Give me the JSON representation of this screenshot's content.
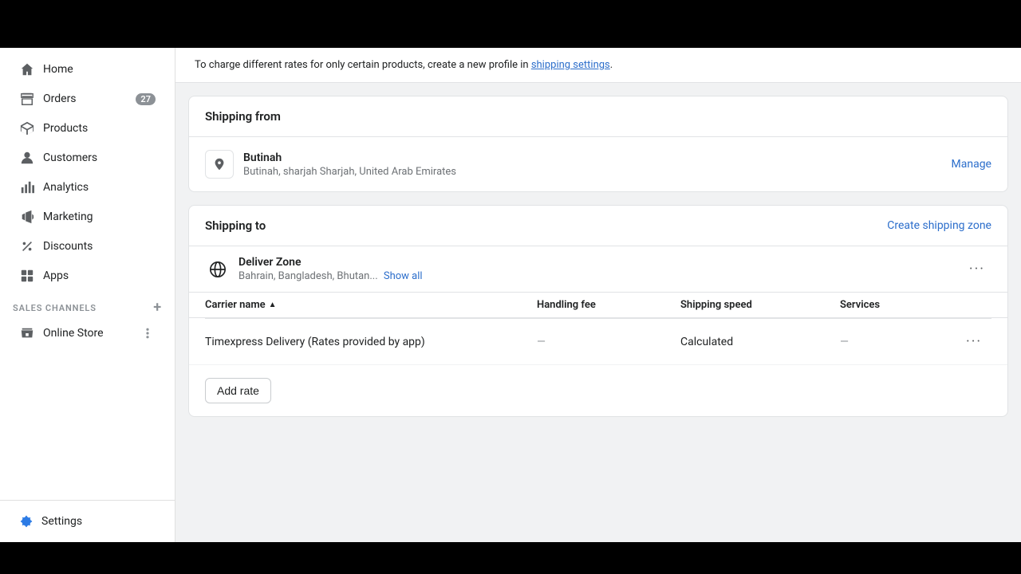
{
  "topBar": {
    "height": 60
  },
  "sidebar": {
    "navItems": [
      {
        "id": "home",
        "label": "Home",
        "icon": "home-icon",
        "badge": null,
        "active": false
      },
      {
        "id": "orders",
        "label": "Orders",
        "icon": "orders-icon",
        "badge": "27",
        "active": false
      },
      {
        "id": "products",
        "label": "Products",
        "icon": "products-icon",
        "badge": null,
        "active": false
      },
      {
        "id": "customers",
        "label": "Customers",
        "icon": "customers-icon",
        "badge": null,
        "active": false
      },
      {
        "id": "analytics",
        "label": "Analytics",
        "icon": "analytics-icon",
        "badge": null,
        "active": false
      },
      {
        "id": "marketing",
        "label": "Marketing",
        "icon": "marketing-icon",
        "badge": null,
        "active": false
      },
      {
        "id": "discounts",
        "label": "Discounts",
        "icon": "discounts-icon",
        "badge": null,
        "active": false
      },
      {
        "id": "apps",
        "label": "Apps",
        "icon": "apps-icon",
        "badge": null,
        "active": false
      }
    ],
    "salesChannelsLabel": "SALES CHANNELS",
    "salesChannelsItems": [
      {
        "id": "online-store",
        "label": "Online Store",
        "icon": "store-icon"
      }
    ],
    "settingsLabel": "Settings",
    "settingsIcon": "settings-icon"
  },
  "infoBanner": {
    "text": "To charge different rates for only certain products, create a new profile in",
    "linkText": "shipping settings",
    "suffix": "."
  },
  "shippingFrom": {
    "sectionTitle": "Shipping from",
    "locationName": "Butinah",
    "locationAddress": "Butinah, sharjah Sharjah, United Arab Emirates",
    "manageLabel": "Manage"
  },
  "shippingTo": {
    "sectionTitle": "Shipping to",
    "createZoneLabel": "Create shipping zone",
    "zone": {
      "name": "Deliver Zone",
      "countries": "Bahrain, Bangladesh, Bhutan...",
      "showAllLabel": "Show all"
    },
    "tableHeaders": {
      "carrierName": "Carrier name",
      "handlingFee": "Handling fee",
      "shippingSpeed": "Shipping speed",
      "services": "Services"
    },
    "carriers": [
      {
        "name": "Timexpress Delivery (Rates provided by app)",
        "handlingFee": "—",
        "shippingSpeed": "Calculated",
        "services": "—"
      }
    ],
    "addRateLabel": "Add rate"
  }
}
